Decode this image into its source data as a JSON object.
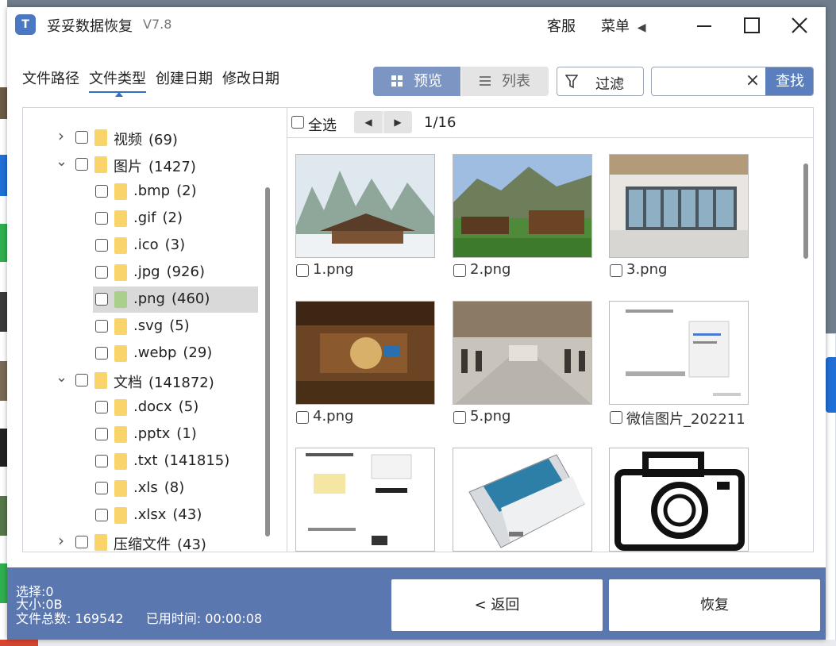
{
  "window": {
    "logo": "T",
    "title": "妥妥数据恢复",
    "version": "V7.8"
  },
  "header": {
    "service_label": "客服",
    "menu_label": "菜单"
  },
  "tabs": [
    {
      "label": "文件路径",
      "active": false
    },
    {
      "label": "文件类型",
      "active": true
    },
    {
      "label": "创建日期",
      "active": false
    },
    {
      "label": "修改日期",
      "active": false
    }
  ],
  "view": {
    "preview_label": "预览",
    "list_label": "列表",
    "active": "preview"
  },
  "filter": {
    "label": "过滤"
  },
  "search": {
    "value": "",
    "placeholder": "",
    "button_label": "查找"
  },
  "tree": [
    {
      "label": "视频",
      "count": "(69)",
      "level": 0,
      "expanded": false,
      "selected": false
    },
    {
      "label": "图片",
      "count": "(1427)",
      "level": 0,
      "expanded": true,
      "selected": false
    },
    {
      "label": ".bmp",
      "count": "(2)",
      "level": 1,
      "selected": false
    },
    {
      "label": ".gif",
      "count": "(2)",
      "level": 1,
      "selected": false
    },
    {
      "label": ".ico",
      "count": "(3)",
      "level": 1,
      "selected": false
    },
    {
      "label": ".jpg",
      "count": "(926)",
      "level": 1,
      "selected": false
    },
    {
      "label": ".png",
      "count": "(460)",
      "level": 1,
      "selected": true
    },
    {
      "label": ".svg",
      "count": "(5)",
      "level": 1,
      "selected": false
    },
    {
      "label": ".webp",
      "count": "(29)",
      "level": 1,
      "selected": false
    },
    {
      "label": "文档",
      "count": "(141872)",
      "level": 0,
      "expanded": true,
      "selected": false
    },
    {
      "label": ".docx",
      "count": "(5)",
      "level": 1,
      "selected": false
    },
    {
      "label": ".pptx",
      "count": "(1)",
      "level": 1,
      "selected": false
    },
    {
      "label": ".txt",
      "count": "(141815)",
      "level": 1,
      "selected": false
    },
    {
      "label": ".xls",
      "count": "(8)",
      "level": 1,
      "selected": false
    },
    {
      "label": ".xlsx",
      "count": "(43)",
      "level": 1,
      "selected": false
    },
    {
      "label": "压缩文件",
      "count": "(43)",
      "level": 0,
      "expanded": false,
      "selected": false
    }
  ],
  "grid": {
    "select_all_label": "全选",
    "page_indicator": "1/16",
    "files": [
      {
        "name": "1.png",
        "thumb": "snowy-lodge-photo"
      },
      {
        "name": "2.png",
        "thumb": "mountain-village-photo"
      },
      {
        "name": "3.png",
        "thumb": "glass-lobby-photo"
      },
      {
        "name": "4.png",
        "thumb": "wooden-hall-interior-photo"
      },
      {
        "name": "5.png",
        "thumb": "museum-corridor-photo"
      },
      {
        "name": "微信图片_202211",
        "thumb": "app-screenshot"
      },
      {
        "name": "",
        "thumb": "phone-screenshots"
      },
      {
        "name": "",
        "thumb": "hard-drive-photo"
      },
      {
        "name": "",
        "thumb": "camera-icon-image"
      }
    ]
  },
  "status": {
    "selected_label": "选择:",
    "selected_value": "0",
    "size_label": "大小:",
    "size_value": "0B",
    "total_label": "文件总数:",
    "total_value": "169542",
    "elapsed_label": "已用时间:",
    "elapsed_value": "00:00:08"
  },
  "actions": {
    "back_label": "< 返回",
    "recover_label": "恢复"
  },
  "colors": {
    "accent": "#5b77b0",
    "toggle_active": "#7c95c2",
    "search_button": "#5b7fbd",
    "folder": "#f8d46a",
    "selected_row": "#d9d9d9"
  }
}
